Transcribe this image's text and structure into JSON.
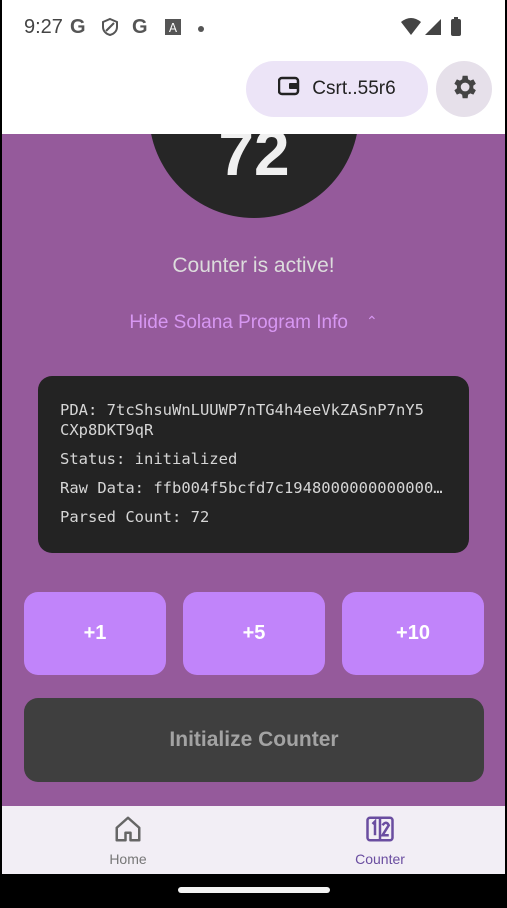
{
  "status_bar": {
    "time": "9:27",
    "notifications": [
      "G",
      "shield-icon",
      "G",
      "A-box-icon",
      "dot"
    ],
    "icons": [
      "wifi-icon",
      "signal-icon",
      "battery-icon"
    ]
  },
  "header": {
    "wallet_label": "Csrt..55r6"
  },
  "counter": {
    "value": "72",
    "status": "Counter is active!",
    "toggle_label": "Hide Solana Program Info"
  },
  "program_info": {
    "pda_line1": "PDA: 7tcShsuWnLUUWP7nTG4h4eeVkZASnP7nY5",
    "pda_line2": "CXp8DKT9qR",
    "status": "Status: initialized",
    "raw_data": "Raw Data: ffb004f5bcfd7c19480000000000000000",
    "parsed_count": "Parsed Count: 72"
  },
  "actions": {
    "plus1": "+1",
    "plus5": "+5",
    "plus10": "+10",
    "initialize": "Initialize Counter"
  },
  "nav": {
    "home": "Home",
    "counter": "Counter"
  },
  "colors": {
    "main_bg": "#955a9b",
    "accent": "#c184fa",
    "link": "#d797f2",
    "nav_active": "#6a4da0"
  }
}
